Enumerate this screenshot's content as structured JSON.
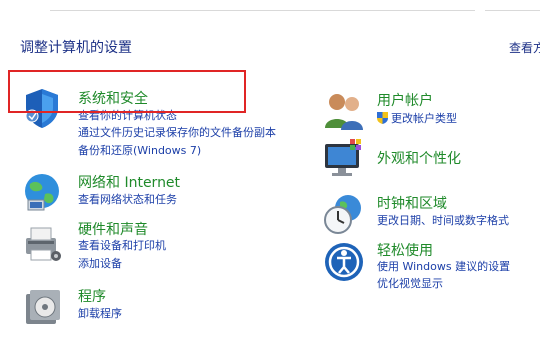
{
  "header": {
    "title": "调整计算机的设置",
    "view_by": "查看方"
  },
  "categories": {
    "system_security": {
      "title": "系统和安全",
      "links": [
        "查看你的计算机状态",
        "通过文件历史记录保存你的文件备份副本",
        "备份和还原(Windows 7)"
      ]
    },
    "network": {
      "title": "网络和 Internet",
      "links": [
        "查看网络状态和任务"
      ]
    },
    "hardware": {
      "title": "硬件和声音",
      "links": [
        "查看设备和打印机",
        "添加设备"
      ]
    },
    "programs": {
      "title": "程序",
      "links": [
        "卸载程序"
      ]
    },
    "user_accounts": {
      "title": "用户帐户",
      "links": [
        "更改帐户类型"
      ]
    },
    "appearance": {
      "title": "外观和个性化",
      "links": []
    },
    "clock_region": {
      "title": "时钟和区域",
      "links": [
        "更改日期、时间或数字格式"
      ]
    },
    "ease_of_access": {
      "title": "轻松使用",
      "links": [
        "使用 Windows 建议的设置",
        "优化视觉显示"
      ]
    }
  },
  "colors": {
    "category_title": "#1f8a2a",
    "link": "#1c3fa8",
    "highlight": "#e02525"
  }
}
